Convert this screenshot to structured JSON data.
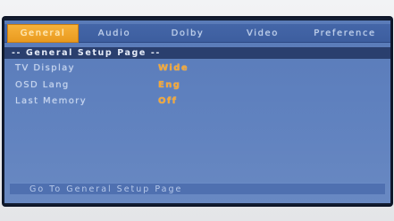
{
  "tabs": [
    {
      "label": "General",
      "active": true
    },
    {
      "label": "Audio",
      "active": false
    },
    {
      "label": "Dolby",
      "active": false
    },
    {
      "label": "Video",
      "active": false
    },
    {
      "label": "Preference",
      "active": false
    }
  ],
  "page_title": "-- General Setup Page --",
  "settings": [
    {
      "label": "TV Display",
      "value": "Wide"
    },
    {
      "label": "OSD Lang",
      "value": "Eng"
    },
    {
      "label": "Last Memory",
      "value": "Off"
    }
  ],
  "status": "Go To General Setup Page",
  "colors": {
    "screen_bg": "#5e80be",
    "active_tab": "#f0a52c",
    "value_text": "#f5a734",
    "title_bar": "#2a3f6e"
  }
}
